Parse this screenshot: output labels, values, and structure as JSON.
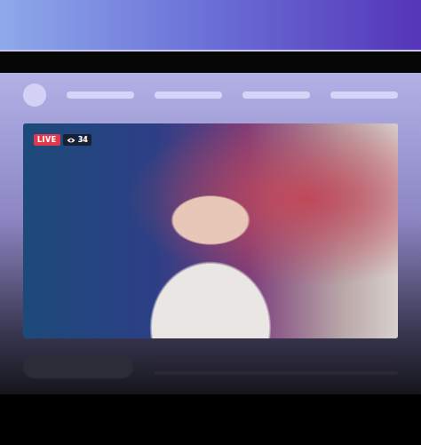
{
  "stream": {
    "badge": "LIVE",
    "viewers": "34"
  }
}
